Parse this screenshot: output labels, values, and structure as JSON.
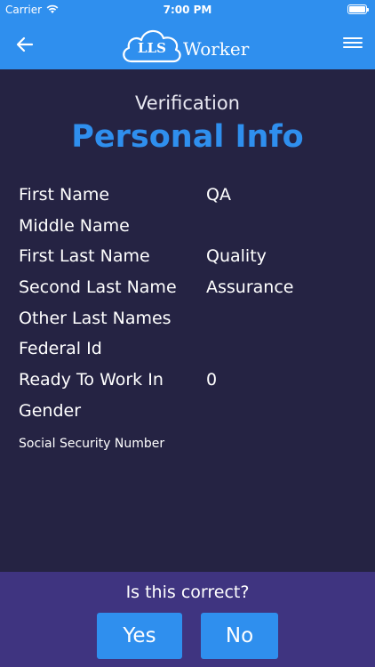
{
  "status_bar": {
    "carrier": "Carrier",
    "time": "7:00 PM",
    "wifi_icon": "wifi-icon",
    "battery_icon": "battery-icon"
  },
  "nav_bar": {
    "back_icon": "arrow-left-icon",
    "menu_icon": "hamburger-menu-icon",
    "logo_mark": "LLS",
    "logo_word": "Worker"
  },
  "header": {
    "subtitle": "Verification",
    "title": "Personal Info"
  },
  "fields": [
    {
      "label": "First Name",
      "value": "QA"
    },
    {
      "label": "Middle Name",
      "value": ""
    },
    {
      "label": "First Last Name",
      "value": "Quality"
    },
    {
      "label": "Second Last Name",
      "value": "Assurance"
    },
    {
      "label": "Other Last Names",
      "value": ""
    },
    {
      "label": "Federal Id",
      "value": ""
    },
    {
      "label": "Ready To Work In",
      "value": "0"
    },
    {
      "label": "Gender",
      "value": ""
    },
    {
      "label": "Social Security Number",
      "value": ""
    }
  ],
  "footer": {
    "question": "Is this correct?",
    "yes_label": "Yes",
    "no_label": "No"
  },
  "colors": {
    "accent": "#2f8fee",
    "background": "#252343",
    "footer": "#3f3480"
  }
}
